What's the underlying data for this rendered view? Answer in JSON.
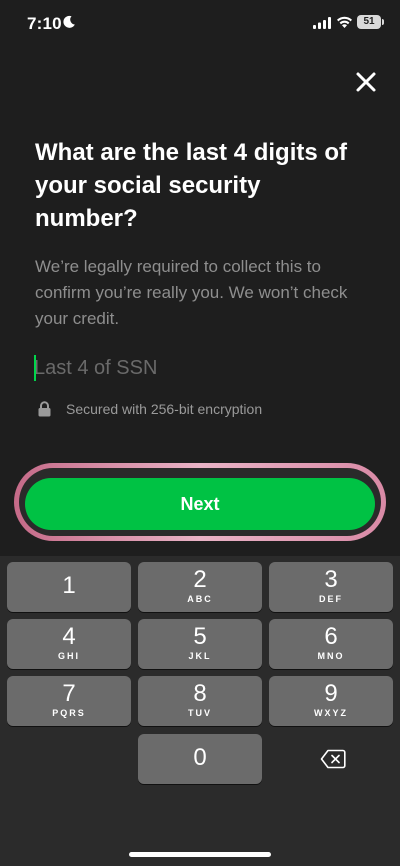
{
  "status_bar": {
    "time": "7:10",
    "battery": "51"
  },
  "header": {
    "close_icon": "close-icon"
  },
  "content": {
    "title": "What are the last 4 digits of your social security number?",
    "subtitle": "We’re legally required to collect this to confirm you’re really you. We won’t check your credit.",
    "ssn_input": {
      "value": "",
      "placeholder": "Last 4 of SSN"
    },
    "secure_note": "Secured with 256-bit encryption"
  },
  "next_button": {
    "label": "Next",
    "color": "#00c244"
  },
  "keypad": {
    "keys": [
      {
        "digit": "1",
        "letters": ""
      },
      {
        "digit": "2",
        "letters": "ABC"
      },
      {
        "digit": "3",
        "letters": "DEF"
      },
      {
        "digit": "4",
        "letters": "GHI"
      },
      {
        "digit": "5",
        "letters": "JKL"
      },
      {
        "digit": "6",
        "letters": "MNO"
      },
      {
        "digit": "7",
        "letters": "PQRS"
      },
      {
        "digit": "8",
        "letters": "TUV"
      },
      {
        "digit": "9",
        "letters": "WXYZ"
      },
      {
        "digit": "0",
        "letters": ""
      }
    ],
    "delete_icon": "backspace-icon"
  }
}
